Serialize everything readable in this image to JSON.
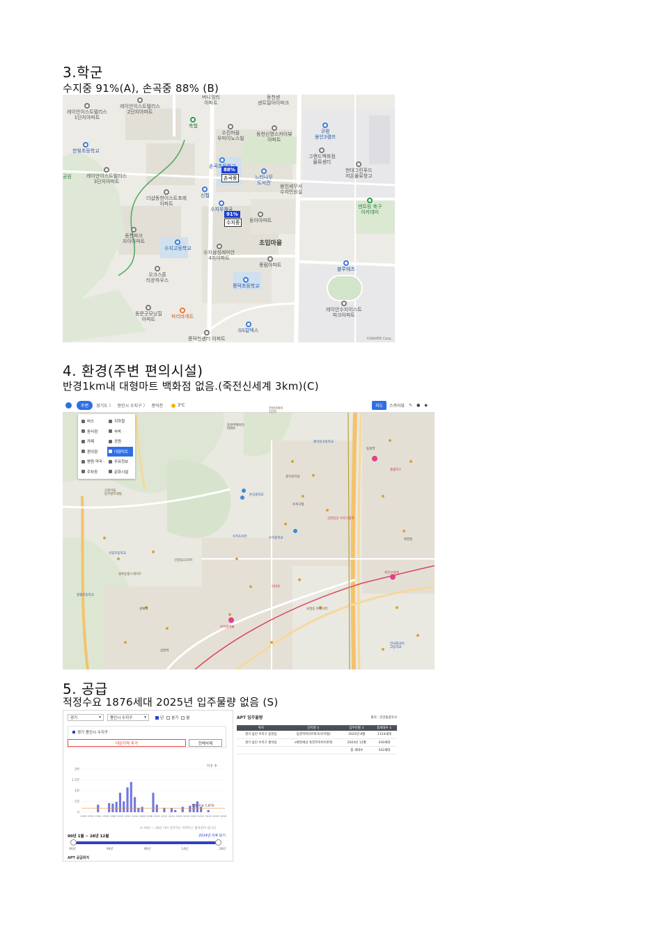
{
  "sections": {
    "school": {
      "heading": "3.학군",
      "subtitle": "수지중 91%(A), 손곡중 88% (B)"
    },
    "environment": {
      "heading": "4. 환경(주변 편의시설)",
      "subtitle": "반경1km내 대형마트 백화점 없음.(죽전신세계 3km)(C)"
    },
    "supply": {
      "heading": "5. 공급",
      "subtitle": "적정수요 1876세대 2025년 입주물량 없음 (S)"
    }
  },
  "map1": {
    "flags": [
      {
        "pct": "88%",
        "name": "손곡중"
      },
      {
        "pct": "91%",
        "name": "수지중"
      }
    ],
    "labels": {
      "l1": "레이안이스트텔리스\n1단지아파트",
      "l2": "레이안이스트텔리스\n2단지아파트",
      "l3": "버니월리\n아파트",
      "l4": "동천센\n센트럴아이파크",
      "l5": "축협",
      "l6": "수진마을\n우미이노스빌",
      "l7": "동천신명스카이뷰\n아파트",
      "l8": "쿠팡\n용인3캠프",
      "l9": "한빛초등학교",
      "l10": "그랜드백화점\n물류센터",
      "l11": "손곡초등학교",
      "l12": "느티나무\n도서관",
      "l13": "현대그린푸드\n저온물류창고",
      "l14": "레이안이스트텔리스\n3단지아파트",
      "l15": "용인세무서\n수지민원실",
      "l16": "더샵동천이스트포레\n아파트",
      "l17": "신협",
      "l18": "수지우체국",
      "l19": "동아아파트",
      "l20": "덴트링 축구\n아카데미",
      "l21": "동천파크\n자이아파트",
      "l22": "초입마을",
      "l23": "수지고등학교",
      "l24": "수지삼성레미안\n4차아파트",
      "l25": "풍림아파트",
      "l26": "블루웨즈",
      "l27": "오크스톤\n타운하우스",
      "l28": "풍덕초등학교",
      "l29": "레이안수지이스트\n파크아파트",
      "l30": "동문굿모닝힐\n아파트",
      "l31": "파리바게트",
      "l32": "GS칼텍스",
      "l33": "풍덕천센터 아파트",
      "l34": "공원"
    },
    "credit": "©NAVER Corp."
  },
  "map2": {
    "toolbar": {
      "pill": "주변",
      "crumbs": [
        "경기도 〉",
        "용인시 수지구 〉",
        "풍덕천"
      ],
      "weather": "3℃",
      "map_btn": "지도",
      "tools": [
        "스카이뷰"
      ]
    },
    "menu": [
      {
        "label": "버스",
        "active": false
      },
      {
        "label": "지하철",
        "active": false
      },
      {
        "label": "음식점",
        "active": false
      },
      {
        "label": "숙박 ·",
        "active": false
      },
      {
        "label": "카페",
        "active": false
      },
      {
        "label": "공원",
        "active": false
      },
      {
        "label": "편의점",
        "active": false
      },
      {
        "label": "대형마트",
        "active": true
      },
      {
        "label": "병원·약국 ·",
        "active": false
      },
      {
        "label": "주유정보",
        "active": false
      },
      {
        "label": "주차장",
        "active": false
      },
      {
        "label": "문화시설",
        "active": false
      }
    ],
    "labels": {
      "a1": "동천주택이안\n아파트",
      "a2": "한성아파트\n1단지",
      "a3": "풍덕천고등학교",
      "a4": "신봉마을\n동부센트레빌",
      "a5": "수지구청",
      "a6": "신분당선 수지구청역",
      "a7": "죽전신세계",
      "a8": "동천역",
      "a9": "수지롯데몰",
      "a10": "신봉초등학교",
      "a11": "성복역",
      "a12": "정평초등학교",
      "a13": "상현역",
      "a14": "한국외국어\n고등학교",
      "a15": "홈플러스",
      "a16": "이마트",
      "a17": "보정동 카페거리",
      "a18": "수지도서관",
      "a19": "풍덕천마을",
      "a20": "성복동힐스테이트",
      "a21": "신봉동LG자이",
      "a22": "죽전동",
      "a23": "손곡중학교",
      "a24": "수지중학교"
    }
  },
  "supply_panel": {
    "select1": "경기",
    "select2": "용인시 수지구",
    "checks": [
      {
        "label": "년",
        "on": true
      },
      {
        "label": "분기",
        "on": false
      },
      {
        "label": "월",
        "on": false
      }
    ],
    "region_chip": "경기 용인시 수지구",
    "add_button": "대상지역 추가",
    "delete_button": "전체삭제",
    "unit": "가구 수",
    "demand_label": "적정 수요 1,876",
    "note": "※ 28년 ~ 28년 사이 입주하는 아파트는 불포함이 됩니다",
    "range_text": "90년 1월 ~ 28년 12월",
    "link_text": "2024년 이후 보기",
    "ticks": [
      "90년",
      "98년",
      "06년",
      "14년",
      "28년"
    ],
    "footer": "APT 공급위치"
  },
  "chart_data": {
    "type": "bar",
    "title": "",
    "xlabel": "",
    "ylabel": "가구 수",
    "y_ticks": [
      "0",
      "5천",
      "1만",
      "1.5만",
      "2만"
    ],
    "ylim": [
      0,
      20000
    ],
    "demand_line": 1876,
    "x_tick_labels": [
      "1990",
      "1992",
      "1994",
      "1996",
      "1998",
      "2000",
      "2002",
      "2004",
      "2006",
      "2008",
      "2010",
      "2012",
      "2014",
      "2016",
      "2018",
      "2020",
      "2022",
      "2024",
      "2026",
      "2028"
    ],
    "categories": [
      "1990",
      "1991",
      "1992",
      "1993",
      "1994",
      "1995",
      "1996",
      "1997",
      "1998",
      "1999",
      "2000",
      "2001",
      "2002",
      "2003",
      "2004",
      "2005",
      "2006",
      "2007",
      "2008",
      "2009",
      "2010",
      "2011",
      "2012",
      "2013",
      "2014",
      "2015",
      "2016",
      "2017",
      "2018",
      "2019",
      "2020",
      "2021",
      "2022",
      "2023",
      "2024",
      "2025",
      "2026",
      "2027",
      "2028"
    ],
    "values": [
      0,
      0,
      0,
      0,
      3500,
      0,
      0,
      4200,
      4000,
      4800,
      9000,
      5000,
      11500,
      14000,
      7000,
      2000,
      2500,
      0,
      0,
      9000,
      3500,
      0,
      2000,
      0,
      1800,
      1000,
      0,
      2500,
      0,
      3000,
      3800,
      5000,
      2500,
      0,
      1000,
      0,
      0,
      0,
      0
    ]
  },
  "apt_table": {
    "title": "APT 입주물량",
    "source": "출처 : 분양물량조사",
    "headers": [
      "위치",
      "단지명 ↕",
      "입주년월 ↕",
      "총세대수 ↕"
    ],
    "rows": [
      [
        "경기 용인 수지구 동천동",
        "동천역지아르파크(수지형)",
        "2025년 8월",
        "1124세대"
      ],
      [
        "경기 용인 수지구 풍덕동",
        "e편한세상 죽전프리미어포레",
        "2024년 12월",
        "430세대"
      ],
      [
        "",
        "",
        "총 세대수",
        "542세대"
      ]
    ]
  }
}
